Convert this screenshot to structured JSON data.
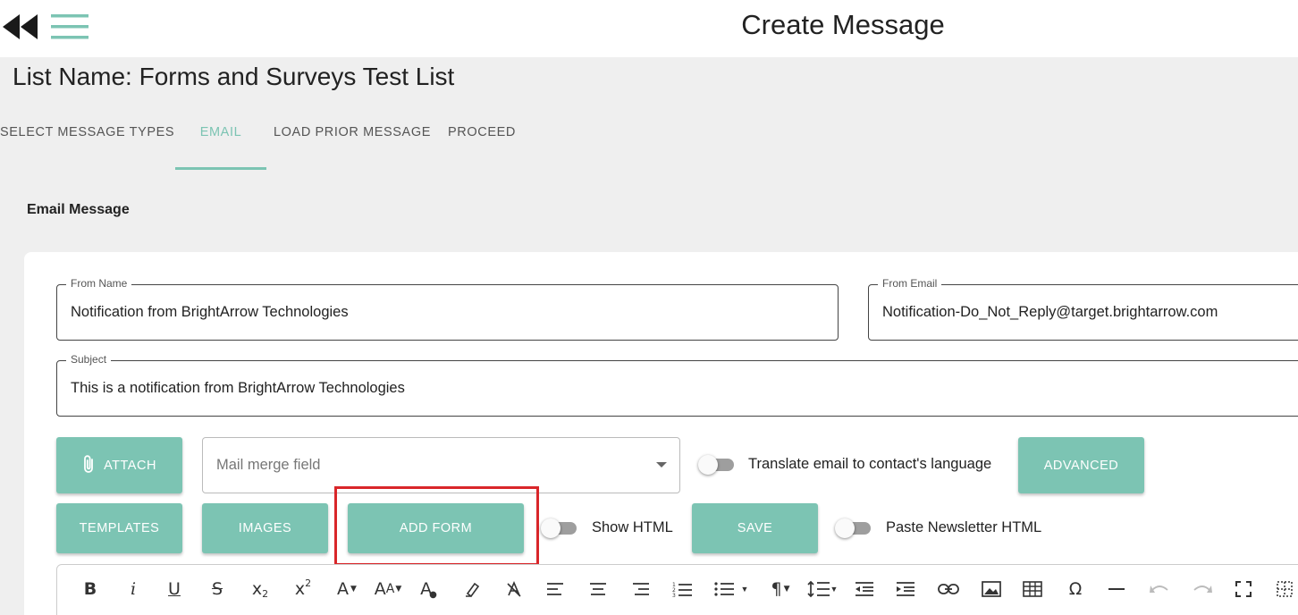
{
  "header": {
    "title": "Create Message",
    "back_icon": "rewind-icon",
    "menu_icon": "hamburger-menu-icon"
  },
  "list_name": "List Name: Forms and Surveys Test List",
  "tabs": [
    {
      "label": "SELECT MESSAGE TYPES",
      "active": false
    },
    {
      "label": "EMAIL",
      "active": true
    },
    {
      "label": "LOAD PRIOR MESSAGE",
      "active": false
    },
    {
      "label": "PROCEED",
      "active": false
    }
  ],
  "section_label": "Email Message",
  "form": {
    "from_name": {
      "label": "From Name",
      "value": "Notification from BrightArrow Technologies"
    },
    "from_email": {
      "label": "From Email",
      "value": "Notification-Do_Not_Reply@target.brightarrow.com"
    },
    "subject": {
      "label": "Subject",
      "value": "This is a notification from BrightArrow Technologies"
    }
  },
  "buttons": {
    "attach": "ATTACH",
    "advanced": "ADVANCED",
    "templates": "TEMPLATES",
    "images": "IMAGES",
    "add_form": "ADD FORM",
    "save": "SAVE"
  },
  "mail_merge": {
    "placeholder": "Mail merge field"
  },
  "toggles": {
    "translate": {
      "label": "Translate email to contact's language",
      "on": false
    },
    "show_html": {
      "label": "Show HTML",
      "on": false
    },
    "paste_newsletter": {
      "label": "Paste Newsletter HTML",
      "on": false
    }
  },
  "editor_toolbar": {
    "items": [
      "bold-icon",
      "italic-icon",
      "underline-icon",
      "strikethrough-icon",
      "subscript-icon",
      "superscript-icon",
      "font-color-icon",
      "font-size-icon",
      "text-color-icon",
      "highlight-icon",
      "clear-format-icon",
      "align-left-icon",
      "align-center-icon",
      "align-right-icon",
      "ordered-list-icon",
      "unordered-list-icon",
      "paragraph-format-icon",
      "line-height-icon",
      "outdent-icon",
      "indent-icon",
      "link-icon",
      "image-icon",
      "table-icon",
      "special-char-icon",
      "horizontal-line-icon",
      "undo-icon",
      "redo-icon",
      "fullscreen-icon",
      "more-icon"
    ]
  },
  "colors": {
    "accent": "#7cc4b3",
    "highlight_box": "#d9262a",
    "background": "#efefef"
  }
}
